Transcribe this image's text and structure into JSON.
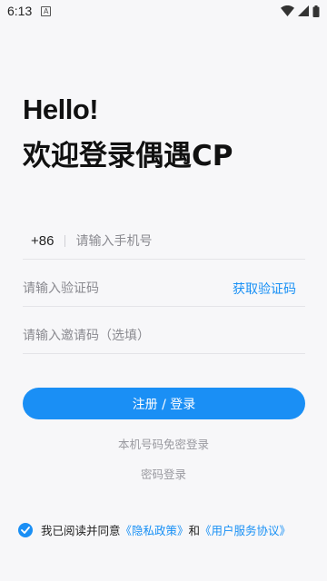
{
  "status_bar": {
    "time": "6:13",
    "notification_letter": "A",
    "icons": [
      "wifi-icon",
      "signal-icon",
      "battery-icon"
    ]
  },
  "title": {
    "hello": "Hello!",
    "welcome": "欢迎登录偶遇CP"
  },
  "form": {
    "country_code": "+86",
    "phone_placeholder": "请输入手机号",
    "code_placeholder": "请输入验证码",
    "get_code_label": "获取验证码",
    "invite_placeholder": "请输入邀请码（选填）"
  },
  "actions": {
    "submit_label": "注册 / 登录",
    "phone_quick_login": "本机号码免密登录",
    "password_login": "密码登录"
  },
  "agreement": {
    "checked": true,
    "prefix": "我已阅读并同意",
    "privacy_link": "《隐私政策》",
    "conjunction": "和",
    "terms_link": "《用户服务协议》"
  },
  "colors": {
    "accent": "#1a8ff5",
    "background": "#f7f7f9",
    "muted_text": "#9a9aa0"
  }
}
